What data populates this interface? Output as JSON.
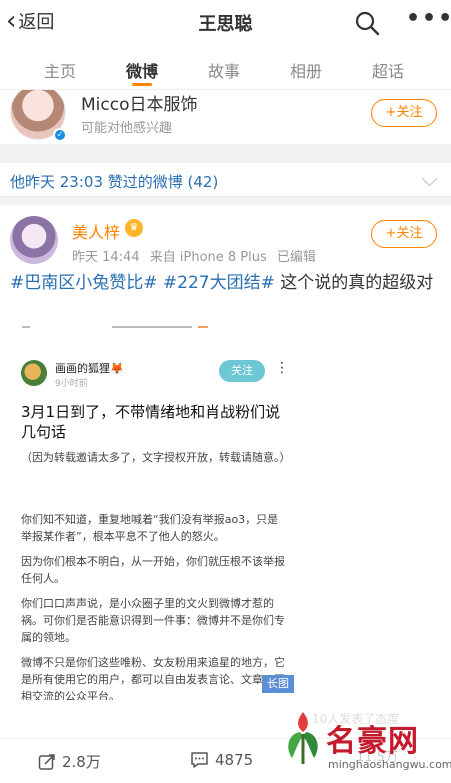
{
  "nav": {
    "back_label": "返回",
    "title": "王思聪"
  },
  "tabs": [
    {
      "label": "主页"
    },
    {
      "label": "微博"
    },
    {
      "label": "故事"
    },
    {
      "label": "相册"
    },
    {
      "label": "超话"
    }
  ],
  "suggest": {
    "name": "Micco日本服饰",
    "subtitle": "可能对他感兴趣",
    "follow_label": "+关注"
  },
  "liked": {
    "text": "他昨天 23:03 赞过的微博 (42)"
  },
  "post": {
    "author": "美人梓",
    "time": "昨天 14:44",
    "source": "来自 iPhone 8 Plus",
    "edited": "已编辑",
    "follow_label": "+关注",
    "tag1": "#巴南区小兔赞比#",
    "tag2": "#227大团结#",
    "text": " 这个说的真的超级对"
  },
  "shot": {
    "name": "画画的狐狸🦊",
    "time": "9小时前",
    "follow_label": "关注",
    "title": "3月1日到了，不带情绪地和肖战粉们说几句话",
    "p1": "（因为转载邀请太多了，文字授权开放，转载请随意。）",
    "p2": "你们知不知道，重复地喊着“我们没有举报ao3，只是举报某作者”，根本平息不了他人的怒火。",
    "p3": "因为你们根本不明白，从一开始，你们就压根不该举报任何人。",
    "p4": "你们口口声声说，是小众圈子里的文火到微博才惹的祸。可你们是否能意识得到一件事：微博并不是你们专属的领地。",
    "p5": "微博不只是你们这些唯粉、女友粉用来追星的地方，它是所有使用它的用户，都可以自由发表言论、文章、互相交流的公众平台。"
  },
  "long_image_label": "长图",
  "actions": {
    "repost": "2.8万",
    "comment": "4875"
  },
  "ghost": {
    "text": "10人发表了态度",
    "count": "11.5万"
  },
  "watermark": {
    "title": "名豪网",
    "sub": "minghaoshangwu.com"
  },
  "colors": {
    "accent": "#ff8200",
    "link": "#2a6fb3",
    "verified": "#1a8ee0"
  }
}
